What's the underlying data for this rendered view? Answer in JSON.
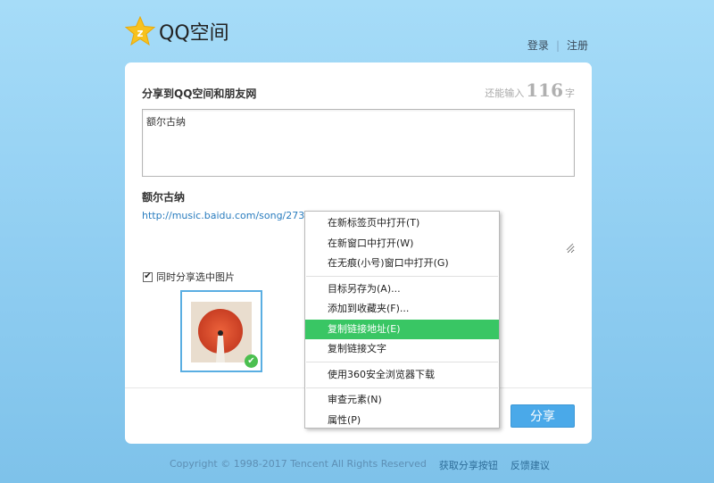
{
  "header": {
    "logo_text": "QQ空间",
    "login": "登录",
    "separator": "|",
    "register": "注册"
  },
  "share": {
    "title": "分享到QQ空间和朋友网",
    "counter_prefix": "还能输入",
    "counter_value": "116",
    "counter_suffix": "字",
    "input_value": "额尔古纳",
    "song_title": "额尔古纳",
    "link_text": "http://music.baidu.com/song/2733",
    "share_image_label": "同时分享选中图片",
    "share_button": "分享"
  },
  "context_menu": {
    "items": [
      "在新标签页中打开(T)",
      "在新窗口中打开(W)",
      "在无痕(小号)窗口中打开(G)",
      "目标另存为(A)...",
      "添加到收藏夹(F)...",
      "复制链接地址(E)",
      "复制链接文字",
      "使用360安全浏览器下载",
      "审查元素(N)",
      "属性(P)"
    ]
  },
  "footer": {
    "copyright": "Copyright © 1998-2017 Tencent All Rights Reserved",
    "get_button": "获取分享按钮",
    "feedback": "反馈建议"
  },
  "colors": {
    "accent": "#4aa9e9",
    "menu_highlight": "#39c664",
    "link": "#2a7dbf"
  }
}
